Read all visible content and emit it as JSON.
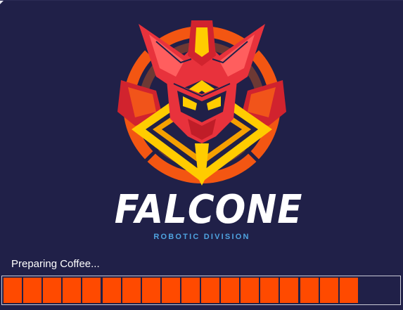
{
  "splash": {
    "brand_name": "FALCONE",
    "brand_subtitle": "ROBOTIC DIVISION",
    "logo_icon": "robot-mech-head-icon",
    "status_text": "Preparing Coffee...",
    "progress": {
      "fraction": 0.89,
      "segments_filled": 18,
      "segments_total": 20
    },
    "colors": {
      "background": "#202048",
      "accent_orange": "#ff4a00",
      "logo_red": "#e8323c",
      "logo_yellow": "#ffcc00",
      "subtitle_blue": "#4fa3e0",
      "text": "#ffffff"
    }
  }
}
